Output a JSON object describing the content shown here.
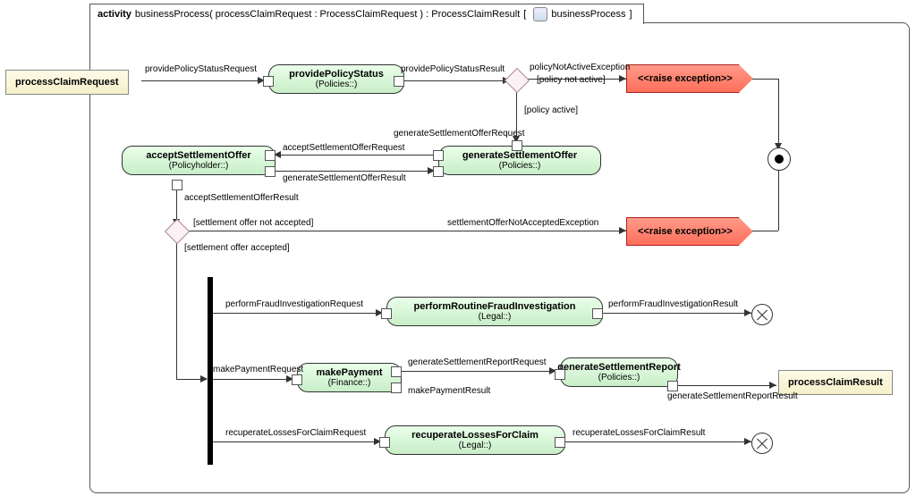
{
  "header": {
    "keyword": "activity",
    "signature": "businessProcess( processClaimRequest : ProcessClaimRequest ) : ProcessClaimResult",
    "tab_label": "businessProcess"
  },
  "actions": {
    "providePolicyStatus": {
      "name": "providePolicyStatus",
      "sub": "(Policies::)"
    },
    "generateSettlementOffer": {
      "name": "generateSettlementOffer",
      "sub": "(Policies::)"
    },
    "acceptSettlementOffer": {
      "name": "acceptSettlementOffer",
      "sub": "(Policyholder::)"
    },
    "performFraud": {
      "name": "performRoutineFraudInvestigation",
      "sub": "(Legal::)"
    },
    "makePayment": {
      "name": "makePayment",
      "sub": "(Finance::)"
    },
    "generateReport": {
      "name": "generateSettlementReport",
      "sub": "(Policies::)"
    },
    "recuperate": {
      "name": "recuperateLossesForClaim",
      "sub": "(Legal::)"
    }
  },
  "exceptions": {
    "raise1": "<<raise exception>>",
    "raise2": "<<raise exception>>"
  },
  "objects": {
    "request": "processClaimRequest",
    "result": "processClaimResult"
  },
  "edges": {
    "providePolicyStatusRequest": "providePolicyStatusRequest",
    "providePolicyStatusResult": "providePolicyStatusResult",
    "policyNotActiveException": "policyNotActiveException",
    "policyNotActiveGuard": "[policy not active]",
    "policyActiveGuard": "[policy active]",
    "generateSettlementOfferRequest": "generateSettlementOfferRequest",
    "acceptSettlementOfferRequest": "acceptSettlementOfferRequest",
    "generateSettlementOfferResult": "generateSettlementOfferResult",
    "acceptSettlementOfferResult": "acceptSettlementOfferResult",
    "settlementNotAccepted": "[settlement offer not accepted]",
    "settlementAccepted": "[settlement offer accepted]",
    "settlementOfferNotAcceptedException": "settlementOfferNotAcceptedException",
    "performFraudInvestigationRequest": "performFraudInvestigationRequest",
    "performFraudInvestigationResult": "performFraudInvestigationResult",
    "makePaymentRequest": "makePaymentRequest",
    "makePaymentResult": "makePaymentResult",
    "generateSettlementReportRequest": "generateSettlementReportRequest",
    "generateSettlementReportResult": "generateSettlementReportResult",
    "recuperateLossesForClaimRequest": "recuperateLossesForClaimRequest",
    "recuperateLossesForClaimResult": "recuperateLossesForClaimResult"
  }
}
